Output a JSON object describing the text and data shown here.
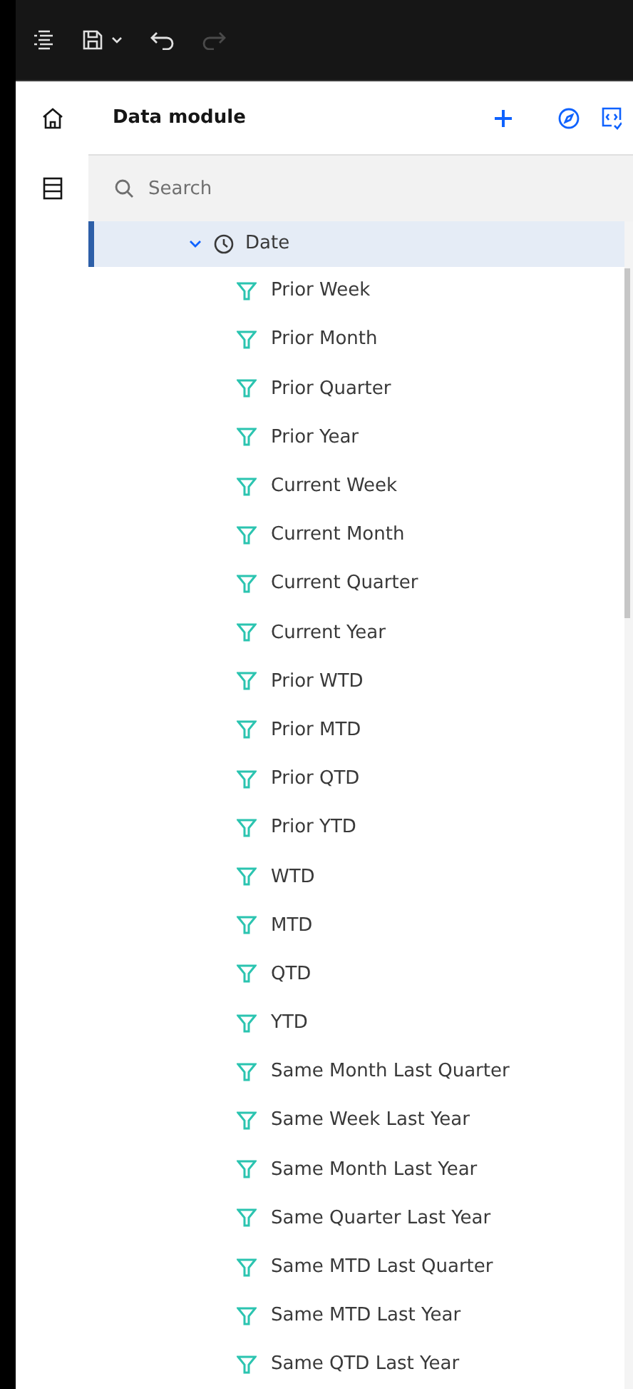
{
  "header": {
    "title": "Data module"
  },
  "search": {
    "placeholder": "Search"
  },
  "tree": [
    {
      "label": "Date",
      "expanded": true,
      "selected": true,
      "children": [
        {
          "label": "Prior Week"
        },
        {
          "label": "Prior Month"
        },
        {
          "label": "Prior Quarter"
        },
        {
          "label": "Prior Year"
        },
        {
          "label": "Current Week"
        },
        {
          "label": "Current Month"
        },
        {
          "label": "Current Quarter"
        },
        {
          "label": "Current Year"
        },
        {
          "label": "Prior WTD"
        },
        {
          "label": "Prior MTD"
        },
        {
          "label": "Prior QTD"
        },
        {
          "label": "Prior YTD"
        },
        {
          "label": "WTD"
        },
        {
          "label": "MTD"
        },
        {
          "label": "QTD"
        },
        {
          "label": "YTD"
        },
        {
          "label": "Same Month Last Quarter"
        },
        {
          "label": "Same Week Last Year"
        },
        {
          "label": "Same Month Last Year"
        },
        {
          "label": "Same Quarter Last Year"
        },
        {
          "label": "Same MTD Last Quarter"
        },
        {
          "label": "Same MTD Last Year"
        },
        {
          "label": "Same QTD Last Year"
        }
      ]
    }
  ]
}
